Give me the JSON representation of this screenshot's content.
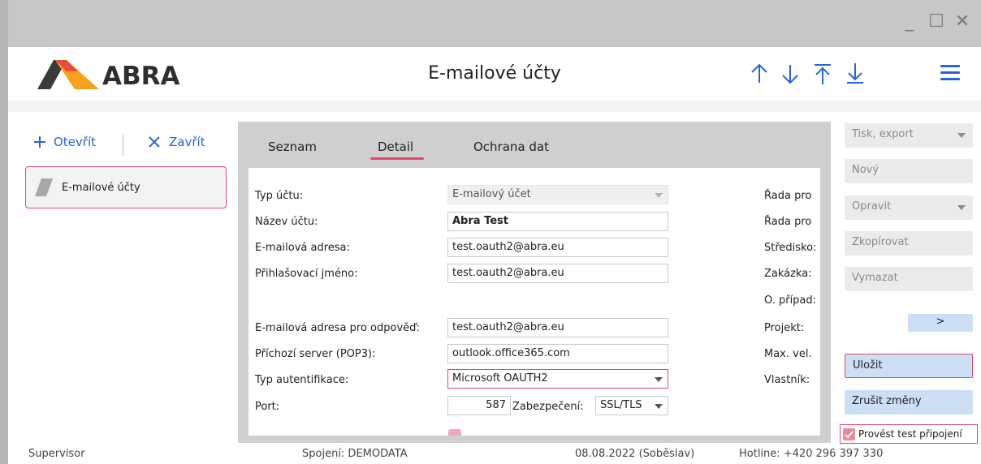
{
  "window": {
    "minimize": "_",
    "maximize": "☐",
    "close": "✕"
  },
  "app": {
    "logo_text": "ABRA",
    "title": "E-mailové účty"
  },
  "colors": {
    "accent": "#2a64d6",
    "highlight": "#e04a6a",
    "logo_orange": "#f7a21c",
    "button_blue": "#cddff5"
  },
  "left_panel": {
    "open_label": "Otevřít",
    "close_label": "Zavřít",
    "nav_item": "E-mailové účty"
  },
  "tabs": [
    {
      "label": "Seznam"
    },
    {
      "label": "Detail",
      "active": true
    },
    {
      "label": "Ochrana dat"
    }
  ],
  "form": {
    "account_type": {
      "label": "Typ účtu:",
      "value": "E-mailový účet"
    },
    "account_name": {
      "label": "Název účtu:",
      "value": "Abra Test"
    },
    "email": {
      "label": "E-mailová adresa:",
      "value": "test.oauth2@abra.eu"
    },
    "login": {
      "label": "Přihlašovací jméno:",
      "value": "test.oauth2@abra.eu"
    },
    "reply_email": {
      "label": "E-mailová adresa pro odpověď:",
      "value": "test.oauth2@abra.eu"
    },
    "incoming_server": {
      "label": "Příchozí server (POP3):",
      "value": "outlook.office365.com"
    },
    "auth_type": {
      "label": "Typ autentifikace:",
      "value": "Microsoft OAUTH2"
    },
    "port": {
      "label": "Port:",
      "value": "587"
    },
    "security": {
      "label": "Zabezpečení:",
      "value": "SSL/TLS"
    }
  },
  "right_labels": [
    "Řada pro",
    "Řada pro",
    "Středisko:",
    "Zakázka:",
    "O. případ:",
    "Projekt:",
    "Max. vel.",
    "Vlastník:"
  ],
  "actions": {
    "print_export": "Tisk, export",
    "new": "Nový",
    "edit": "Opravit",
    "copy": "Zkopírovat",
    "delete": "Vymazat",
    "more": ">",
    "save": "Uložit",
    "cancel": "Zrušit změny",
    "test_connection": "Provést test připojení"
  },
  "status": {
    "user": "Supervisor",
    "connection": "Spojení: DEMODATA",
    "date": "08.08.2022 (Soběslav)",
    "hotline": "Hotline: +420 296 397 330"
  }
}
